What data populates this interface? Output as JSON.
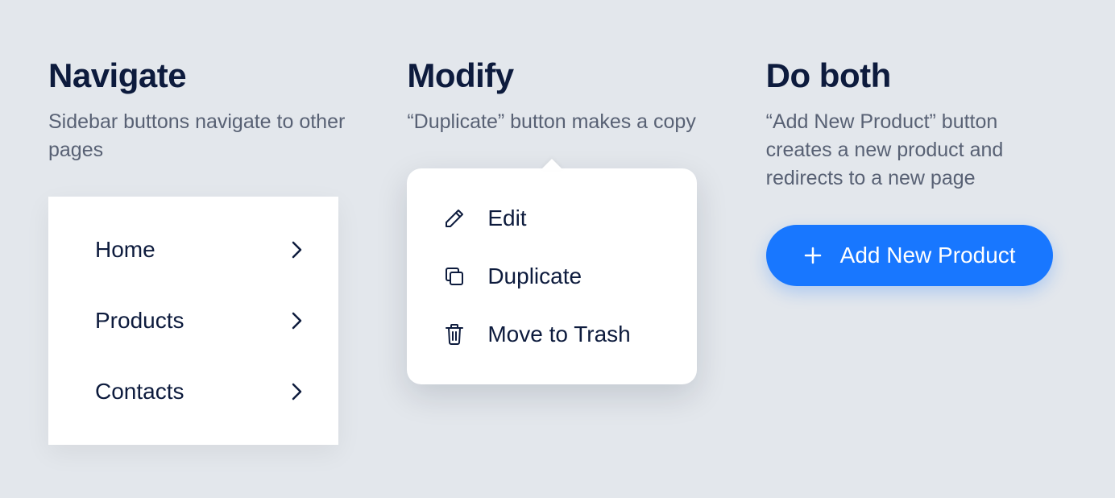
{
  "navigate": {
    "title": "Navigate",
    "desc": "Sidebar buttons navigate to other pages",
    "items": [
      {
        "label": "Home"
      },
      {
        "label": "Products"
      },
      {
        "label": "Contacts"
      }
    ]
  },
  "modify": {
    "title": "Modify",
    "desc": "“Duplicate” button makes a copy",
    "menu": [
      {
        "label": "Edit",
        "icon": "pencil-icon"
      },
      {
        "label": "Duplicate",
        "icon": "copy-icon"
      },
      {
        "label": "Move to Trash",
        "icon": "trash-icon"
      }
    ]
  },
  "doboth": {
    "title": "Do both",
    "desc": "“Add New Product” button creates a new product and redirects to a new page",
    "button_label": "Add New Product"
  },
  "colors": {
    "primary": "#1877ff",
    "text": "#0d1b3d",
    "muted": "#586174",
    "bg": "#e3e7ec"
  }
}
